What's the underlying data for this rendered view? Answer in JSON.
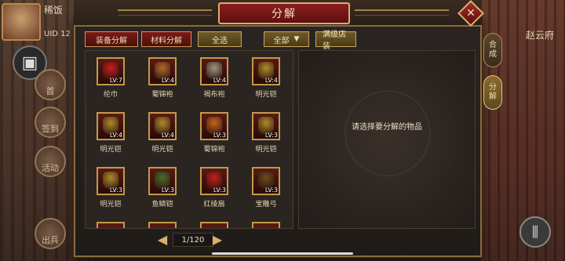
{
  "player": {
    "name": "稀饭",
    "uid": "UID 12"
  },
  "side_buttons": [
    "首",
    "签到",
    "活动",
    "出兵"
  ],
  "right_title": "赵云府",
  "dialog": {
    "title": "分解",
    "close_glyph": "✕"
  },
  "toolbar": {
    "equip_decompose": "装备分解",
    "material_decompose": "材料分解",
    "select_all": "全选",
    "filter": "全部",
    "full_level": "满级店装"
  },
  "tabs": [
    {
      "label": [
        "合",
        "成"
      ],
      "active": false
    },
    {
      "label": [
        "分",
        "解"
      ],
      "active": true
    }
  ],
  "items": [
    {
      "name": "纶巾",
      "lv": "LV:7",
      "color": "#c81d1d"
    },
    {
      "name": "蜀锦袍",
      "lv": "LV:4",
      "color": "#b26a2a"
    },
    {
      "name": "褐布袍",
      "lv": "LV:4",
      "color": "#a09080"
    },
    {
      "name": "明光铠",
      "lv": "LV:4",
      "color": "#b08a2a"
    },
    {
      "name": "明光铠",
      "lv": "LV:4",
      "color": "#b08a2a"
    },
    {
      "name": "明光铠",
      "lv": "LV:4",
      "color": "#b08a2a"
    },
    {
      "name": "蜀锦袍",
      "lv": "LV:3",
      "color": "#c8641e"
    },
    {
      "name": "明光铠",
      "lv": "LV:3",
      "color": "#b08a2a"
    },
    {
      "name": "明光铠",
      "lv": "LV:3",
      "color": "#b08a2a"
    },
    {
      "name": "鱼鳞铠",
      "lv": "LV:3",
      "color": "#4e6a2a"
    },
    {
      "name": "红绫扇",
      "lv": "LV:3",
      "color": "#c0201c"
    },
    {
      "name": "宝雕弓",
      "lv": "LV:3",
      "color": "#6a4a20"
    }
  ],
  "info_text": "请选择要分解的物品",
  "pager": {
    "text": "1/120",
    "prev": "◀",
    "next": "▶"
  }
}
